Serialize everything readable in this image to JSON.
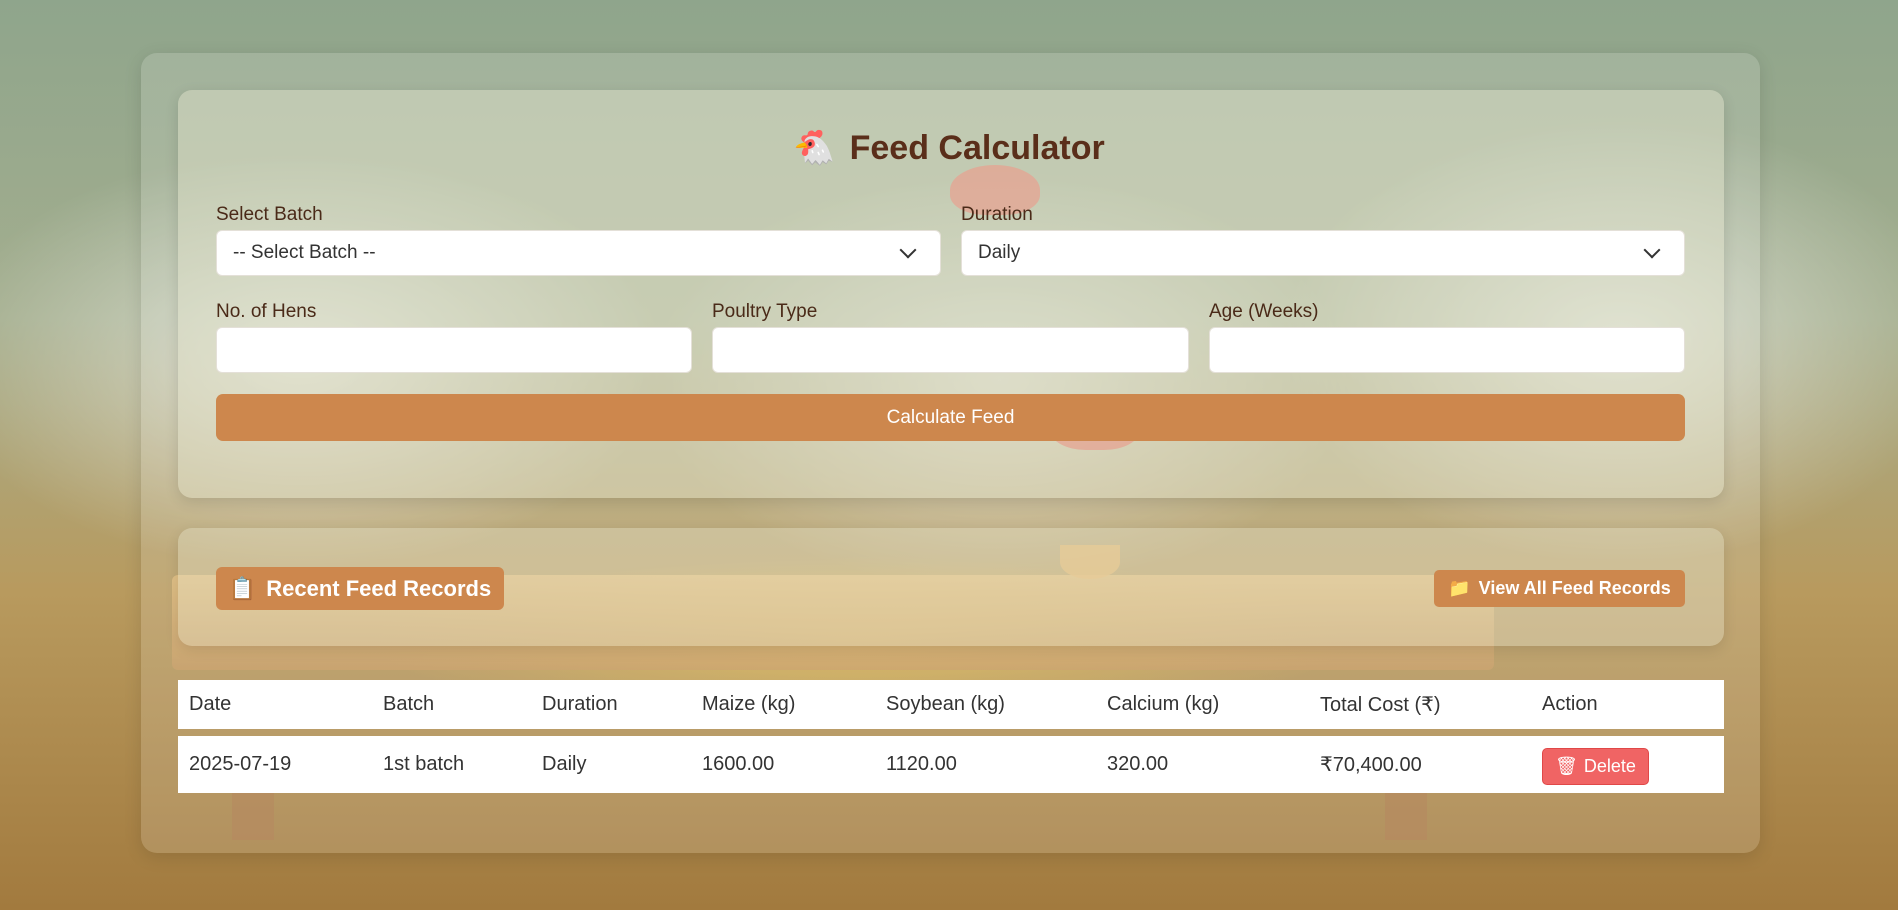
{
  "page": {
    "title": "Feed Calculator",
    "title_icon": "🐔"
  },
  "form": {
    "batch_label": "Select Batch",
    "batch_value": "-- Select Batch --",
    "duration_label": "Duration",
    "duration_value": "Daily",
    "hens_label": "No. of Hens",
    "hens_value": "",
    "poultry_label": "Poultry Type",
    "poultry_value": "",
    "age_label": "Age (Weeks)",
    "age_value": "",
    "calculate_label": "Calculate Feed"
  },
  "records": {
    "title": "Recent Feed Records",
    "title_icon": "📋",
    "view_all_label": "View All Feed Records",
    "view_all_icon": "📁",
    "columns": [
      "Date",
      "Batch",
      "Duration",
      "Maize (kg)",
      "Soybean (kg)",
      "Calcium (kg)",
      "Total Cost (₹)",
      "Action"
    ],
    "rows": [
      {
        "date": "2025-07-19",
        "batch": "1st batch",
        "duration": "Daily",
        "maize": "1600.00",
        "soybean": "1120.00",
        "calcium": "320.00",
        "total_cost": "₹70,400.00",
        "action_label": "Delete",
        "action_icon": "🗑"
      }
    ]
  },
  "colors": {
    "accent": "#cd874d",
    "title_text": "#5a2e1a",
    "delete": "#f06464"
  }
}
